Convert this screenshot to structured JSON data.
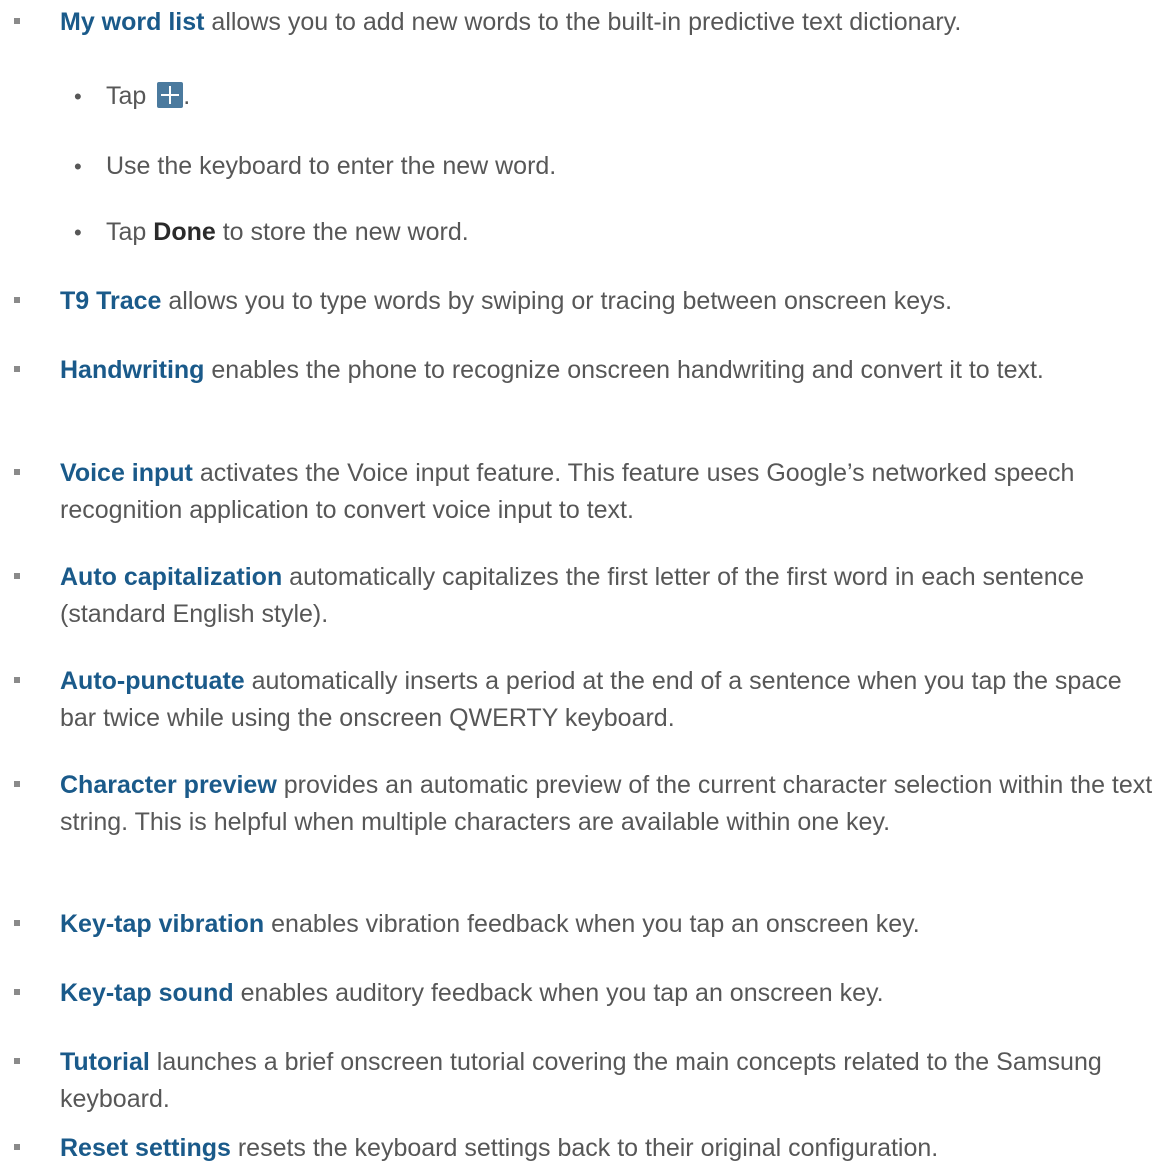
{
  "colors": {
    "text": "#575757",
    "term": "#1a5a8a",
    "bullet": "#8a8a8a",
    "plus_icon_bg": "#4b7a9e"
  },
  "items": [
    {
      "term": "My word list",
      "text": " allows you to add new words to the built-in predictive text dictionary.",
      "sub_items": [
        {
          "prefix": "Tap ",
          "icon": "plus-icon",
          "suffix": "."
        },
        {
          "text": "Use the keyboard to enter the new word."
        },
        {
          "prefix": "Tap ",
          "term": "Done",
          "suffix": " to store the new word."
        }
      ]
    },
    {
      "term": "T9 Trace",
      "text": " allows you to type words by swiping or tracing between onscreen keys."
    },
    {
      "term": "Handwriting",
      "text": " enables the phone to recognize onscreen handwriting and convert it to text."
    },
    {
      "term": "Voice input",
      "text": " activates the Voice input feature. This feature uses Google’s networked speech recognition application to convert voice input to text."
    },
    {
      "term": "Auto capitalization",
      "text": " automatically capitalizes the first letter of the first word in each sentence (standard English style)."
    },
    {
      "term": "Auto-punctuate",
      "text": " automatically inserts a period at the end of a sentence when you tap the space bar twice while using the onscreen QWERTY keyboard."
    },
    {
      "term": "Character preview",
      "text": " provides an automatic preview of the current character selection within the text string. This is helpful when multiple characters are available within one key."
    },
    {
      "term": "Key-tap vibration",
      "text": " enables vibration feedback when you tap an onscreen key."
    },
    {
      "term": "Key-tap sound",
      "text": " enables auditory feedback when you tap an onscreen key."
    },
    {
      "term": "Tutorial",
      "text": " launches a brief onscreen tutorial covering the main concepts related to the Samsung keyboard."
    },
    {
      "term": "Reset settings",
      "text": " resets the keyboard settings back to their original configuration."
    }
  ]
}
